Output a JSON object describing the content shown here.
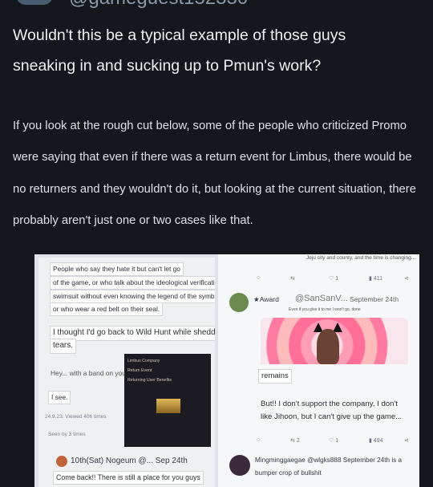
{
  "post": {
    "handle": "@gameguest152330",
    "title_lines": [
      "Wouldn't this be a typical example of those guys",
      "sneaking in and sucking up to Pmun's work?"
    ],
    "body_lines": [
      "If you look at the rough cut below, some of the people who criticized Promo",
      "were saying that even if there was a return event for Limbus, there would be",
      "no returners and they wouldn't do it, but looking at the current situation, there",
      "probably aren't just one or two cases like that."
    ]
  },
  "left_panel": {
    "bubbles": [
      "People who say they hate it but can't let go",
      "of the game, or who talk about the ideological verification",
      "swimsuit without even knowing the legend of the symbol emitter,",
      "or who wear a red belt on their seal."
    ],
    "big_bubble_1": "I thought I'd go back to Wild Hunt while shedding",
    "big_bubble_2": "tears.",
    "hey_bubble": "Hey... with a band on your head",
    "i_see": "I see.",
    "timestamp": "24.9.23. Viewed 406 times",
    "seen": "Seen by 3 times",
    "ad_lines": [
      "Limbus Company",
      "Return Event",
      "Returning User Benefits"
    ],
    "bottom_user": "10th(Sat) Nogeum @... Sep 24th",
    "bottom_text": "Come back!! There is still a place for you guys"
  },
  "right_panel": {
    "top_caption": "Jeju city and county, and the time is changing...",
    "top_actions": {
      "likes": "1",
      "views": "411"
    },
    "award_user": "★Award",
    "award_handle": "@SanSanV...",
    "award_date": "September 24th",
    "award_sub": "Even if you give it to me I won't go, done",
    "remains": "remains",
    "support_1": "But!! I don't support the company, I don't",
    "support_2": "like Jihoon, but I can't give up the game...",
    "bottom_actions": {
      "retweets": "2",
      "likes": "1",
      "views": "494"
    },
    "ming_line_1": "Mingminggaegae @wlgks888 September 24th is a",
    "ming_line_2": "bumper crop of bullshit"
  },
  "colors": {
    "background": "#14171c",
    "text": "#e8eaed",
    "panel": "#f4f5f7"
  }
}
